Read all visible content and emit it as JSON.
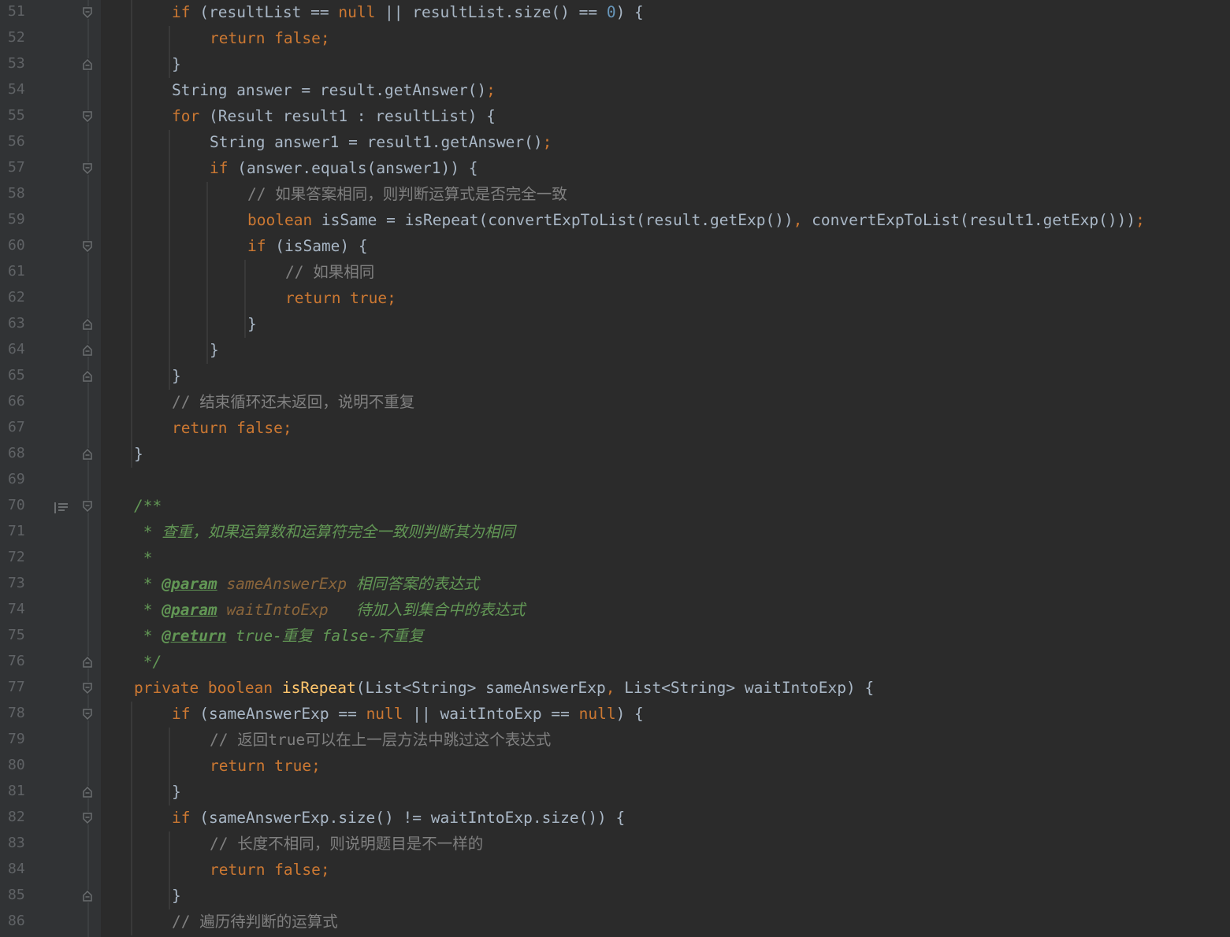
{
  "editor": {
    "theme_colors": {
      "background": "#2b2b2b",
      "gutter": "#313335",
      "keyword": "#cc7832",
      "number": "#6897bb",
      "comment": "#808080",
      "method": "#ffc66d",
      "doc_comment": "#629755",
      "text": "#a9b7c6"
    },
    "lines": [
      {
        "n": "51",
        "t": [
          [
            "kw",
            "if "
          ],
          [
            "",
            "(resultList == "
          ],
          [
            "kw",
            "null"
          ],
          [
            "",
            " || resultList.size() == "
          ],
          [
            "num",
            "0"
          ],
          [
            "",
            ") {"
          ]
        ]
      },
      {
        "n": "52",
        "t": [
          [
            "kw",
            "return false;"
          ]
        ]
      },
      {
        "n": "53",
        "t": [
          [
            "",
            "}"
          ]
        ]
      },
      {
        "n": "54",
        "t": [
          [
            "",
            "String answer = result.getAnswer()"
          ],
          [
            "kw",
            ";"
          ]
        ]
      },
      {
        "n": "55",
        "t": [
          [
            "kw",
            "for "
          ],
          [
            "",
            "(Result result1 : resultList) {"
          ]
        ]
      },
      {
        "n": "56",
        "t": [
          [
            "",
            "String answer1 = result1.getAnswer()"
          ],
          [
            "kw",
            ";"
          ]
        ]
      },
      {
        "n": "57",
        "t": [
          [
            "kw",
            "if "
          ],
          [
            "",
            "(answer.equals(answer1)) {"
          ]
        ]
      },
      {
        "n": "58",
        "t": [
          [
            "cm",
            "// "
          ],
          [
            "cm-cjk",
            "如果答案相同，则判断运算式是否完全一致"
          ]
        ]
      },
      {
        "n": "59",
        "t": [
          [
            "kw",
            "boolean "
          ],
          [
            "",
            "isSame = isRepeat(convertExpToList(result.getExp())"
          ],
          [
            "kw",
            ", "
          ],
          [
            "",
            "convertExpToList(result1.getExp()))"
          ],
          [
            "kw",
            ";"
          ]
        ]
      },
      {
        "n": "60",
        "t": [
          [
            "kw",
            "if "
          ],
          [
            "",
            "(isSame) {"
          ]
        ]
      },
      {
        "n": "61",
        "t": [
          [
            "cm",
            "// "
          ],
          [
            "cm-cjk",
            "如果相同"
          ]
        ]
      },
      {
        "n": "62",
        "t": [
          [
            "kw",
            "return true;"
          ]
        ]
      },
      {
        "n": "63",
        "t": [
          [
            "",
            "}"
          ]
        ]
      },
      {
        "n": "64",
        "t": [
          [
            "",
            "}"
          ]
        ]
      },
      {
        "n": "65",
        "t": [
          [
            "",
            "}"
          ]
        ]
      },
      {
        "n": "66",
        "t": [
          [
            "cm",
            "// "
          ],
          [
            "cm-cjk",
            "结束循环还未返回，说明不重复"
          ]
        ]
      },
      {
        "n": "67",
        "t": [
          [
            "kw",
            "return false;"
          ]
        ]
      },
      {
        "n": "68",
        "t": [
          [
            "",
            "}"
          ]
        ]
      },
      {
        "n": "69",
        "t": []
      },
      {
        "n": "70",
        "t": [
          [
            "doc",
            "/**"
          ]
        ]
      },
      {
        "n": "71",
        "t": [
          [
            "doc",
            " * "
          ],
          [
            "doc-cjk",
            "查重，如果运算数和运算符完全一致则判断其为相同"
          ]
        ]
      },
      {
        "n": "72",
        "t": [
          [
            "doc",
            " *"
          ]
        ]
      },
      {
        "n": "73",
        "t": [
          [
            "doc",
            " * "
          ],
          [
            "doc-tag",
            "@param"
          ],
          [
            "doc",
            " "
          ],
          [
            "doc-param",
            "sameAnswerExp"
          ],
          [
            "doc",
            " "
          ],
          [
            "doc-cjk",
            "相同答案的表达式"
          ]
        ]
      },
      {
        "n": "74",
        "t": [
          [
            "doc",
            " * "
          ],
          [
            "doc-tag",
            "@param"
          ],
          [
            "doc",
            " "
          ],
          [
            "doc-param",
            "waitIntoExp"
          ],
          [
            "doc",
            "   "
          ],
          [
            "doc-cjk",
            "待加入到集合中的表达式"
          ]
        ]
      },
      {
        "n": "75",
        "t": [
          [
            "doc",
            " * "
          ],
          [
            "doc-tag",
            "@return"
          ],
          [
            "doc",
            " true-"
          ],
          [
            "doc-cjk",
            "重复"
          ],
          [
            "doc",
            " false-"
          ],
          [
            "doc-cjk",
            "不重复"
          ]
        ]
      },
      {
        "n": "76",
        "t": [
          [
            "doc",
            " */"
          ]
        ]
      },
      {
        "n": "77",
        "t": [
          [
            "kw",
            "private boolean "
          ],
          [
            "fn",
            "isRepeat"
          ],
          [
            "",
            "(List<String> sameAnswerExp"
          ],
          [
            "kw",
            ", "
          ],
          [
            "",
            "List<String> waitIntoExp) {"
          ]
        ]
      },
      {
        "n": "78",
        "t": [
          [
            "kw",
            "if "
          ],
          [
            "",
            "(sameAnswerExp == "
          ],
          [
            "kw",
            "null"
          ],
          [
            "",
            " || waitIntoExp == "
          ],
          [
            "kw",
            "null"
          ],
          [
            "",
            ") {"
          ]
        ]
      },
      {
        "n": "79",
        "t": [
          [
            "cm",
            "// "
          ],
          [
            "cm-cjk",
            "返回"
          ],
          [
            "cm",
            "true"
          ],
          [
            "cm-cjk",
            "可以在上一层方法中跳过这个表达式"
          ]
        ]
      },
      {
        "n": "80",
        "t": [
          [
            "kw",
            "return true;"
          ]
        ]
      },
      {
        "n": "81",
        "t": [
          [
            "",
            "}"
          ]
        ]
      },
      {
        "n": "82",
        "t": [
          [
            "kw",
            "if "
          ],
          [
            "",
            "(sameAnswerExp.size() != waitIntoExp.size()) {"
          ]
        ]
      },
      {
        "n": "83",
        "t": [
          [
            "cm",
            "// "
          ],
          [
            "cm-cjk",
            "长度不相同，则说明题目是不一样的"
          ]
        ]
      },
      {
        "n": "84",
        "t": [
          [
            "kw",
            "return false;"
          ]
        ]
      },
      {
        "n": "85",
        "t": [
          [
            "",
            "}"
          ]
        ]
      },
      {
        "n": "86",
        "t": [
          [
            "cm",
            "// "
          ],
          [
            "cm-cjk",
            "遍历待判断的运算式"
          ]
        ]
      }
    ]
  }
}
